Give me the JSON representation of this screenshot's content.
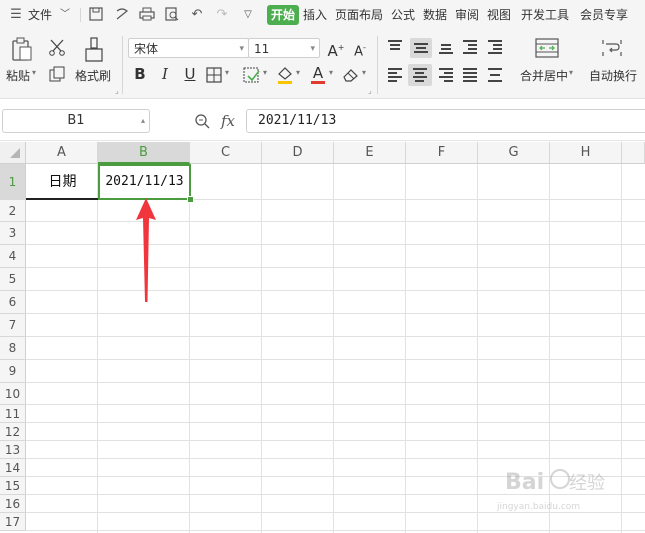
{
  "menu": {
    "hamburger_icon": "menu-icon",
    "file_label": "文件",
    "tabs": [
      "开始",
      "插入",
      "页面布局",
      "公式",
      "数据",
      "审阅",
      "视图",
      "开发工具",
      "会员专享"
    ]
  },
  "ribbon": {
    "paste_label": "粘贴",
    "format_painter_label": "格式刷",
    "font_name": "宋体",
    "font_size": "11",
    "merge_center_label": "合并居中",
    "wrap_text_label": "自动换行",
    "bold": "B",
    "italic": "I",
    "underline": "U",
    "font_color_letter": "A",
    "increase_font": "A",
    "decrease_font": "A"
  },
  "formula_bar": {
    "name_box": "B1",
    "fx_label": "fx",
    "formula_value": "2021/11/13"
  },
  "grid": {
    "columns": [
      "A",
      "B",
      "C",
      "D",
      "E",
      "F",
      "G",
      "H"
    ],
    "rows": [
      "1",
      "2",
      "3",
      "4",
      "5",
      "6",
      "7",
      "8",
      "9",
      "10",
      "11",
      "12",
      "13",
      "14",
      "15",
      "16",
      "17"
    ],
    "cells": {
      "A1": "日期",
      "B1": "2021/11/13"
    },
    "selected_cell": "B1",
    "selection_color": "#4a9c3e",
    "annotation_color": "#f0353d"
  },
  "watermark": {
    "brand": "Baidu经验",
    "url": "jingyan.baidu.com"
  },
  "colors": {
    "accent": "#4cae4f",
    "toolbar_bg": "#f5f5f5"
  }
}
